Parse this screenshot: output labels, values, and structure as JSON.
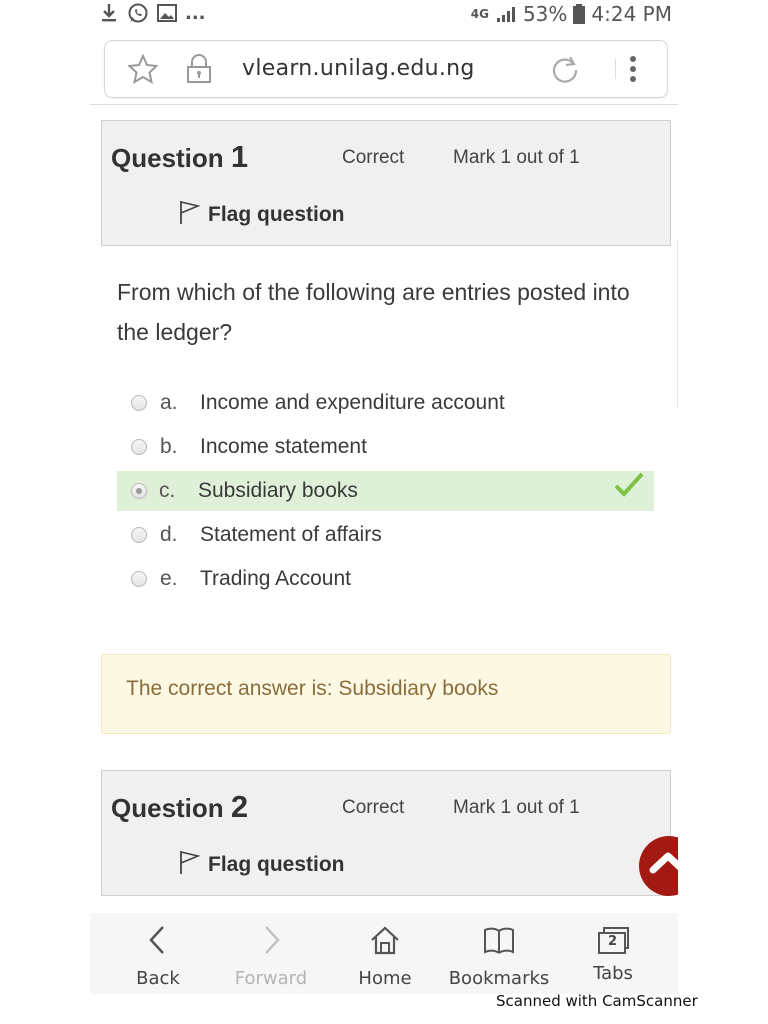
{
  "status_bar": {
    "network": "4G",
    "battery": "53%",
    "time": "4:24 PM",
    "overflow": "...",
    "icons": [
      "download-icon",
      "whatsapp-icon",
      "gallery-icon",
      "signal-icon",
      "battery-icon"
    ]
  },
  "browser": {
    "url": "vlearn.unilag.edu.ng"
  },
  "questions": [
    {
      "label": "Question",
      "number": "1",
      "state": "Correct",
      "grade": "Mark 1 out of 1",
      "flag_label": "Flag question",
      "text": "From which of the following are entries posted into the ledger?",
      "options": [
        {
          "letter": "a.",
          "text": "Income and expenditure account",
          "selected": false
        },
        {
          "letter": "b.",
          "text": "Income statement",
          "selected": false
        },
        {
          "letter": "c.",
          "text": "Subsidiary books",
          "selected": true,
          "correct": true
        },
        {
          "letter": "d.",
          "text": "Statement of affairs",
          "selected": false
        },
        {
          "letter": "e.",
          "text": "Trading Account",
          "selected": false
        }
      ],
      "feedback": "The correct answer is: Subsidiary books"
    },
    {
      "label": "Question",
      "number": "2",
      "state": "Correct",
      "grade": "Mark 1 out of 1",
      "flag_label": "Flag question"
    }
  ],
  "nav": {
    "back": "Back",
    "forward": "Forward",
    "home": "Home",
    "bookmarks": "Bookmarks",
    "tabs": "Tabs",
    "tab_count": "2"
  },
  "watermark": "Scanned with CamScanner",
  "colors": {
    "selected_bg": "#dff0d8",
    "check": "#7dc145",
    "feedback_bg": "#fcf8e3",
    "feedback_text": "#8a6d3b",
    "scroll_top": "#a31a12"
  }
}
